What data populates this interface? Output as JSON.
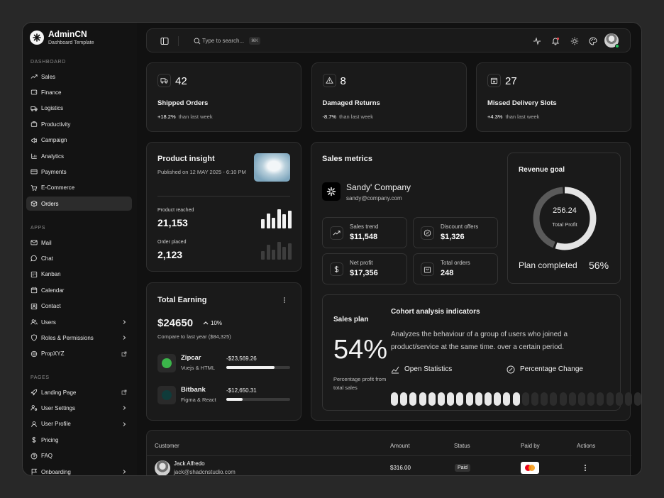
{
  "brand": {
    "title": "AdminCN",
    "subtitle": "Dashboard Template"
  },
  "sidebar": {
    "dashboard_label": "DASHBOARD",
    "apps_label": "APPS",
    "pages_label": "PAGES",
    "dashboard_items": [
      {
        "label": "Sales",
        "icon": "trending-up-icon"
      },
      {
        "label": "Finance",
        "icon": "wallet-icon"
      },
      {
        "label": "Logistics",
        "icon": "truck-icon"
      },
      {
        "label": "Productivity",
        "icon": "briefcase-icon"
      },
      {
        "label": "Campaign",
        "icon": "megaphone-icon"
      },
      {
        "label": "Analytics",
        "icon": "bar-chart-icon"
      },
      {
        "label": "Payments",
        "icon": "credit-card-icon"
      },
      {
        "label": "E-Commerce",
        "icon": "cart-icon"
      },
      {
        "label": "Orders",
        "icon": "box-icon"
      }
    ],
    "app_items": [
      {
        "label": "Mail",
        "icon": "mail-icon"
      },
      {
        "label": "Chat",
        "icon": "chat-icon"
      },
      {
        "label": "Kanban",
        "icon": "kanban-icon"
      },
      {
        "label": "Calendar",
        "icon": "calendar-icon"
      },
      {
        "label": "Contact",
        "icon": "contact-icon"
      },
      {
        "label": "Users",
        "icon": "users-icon"
      },
      {
        "label": "Roles & Permissions",
        "icon": "shield-icon"
      },
      {
        "label": "PropXYZ",
        "icon": "link-icon"
      }
    ],
    "page_items": [
      {
        "label": "Landing Page",
        "icon": "rocket-icon"
      },
      {
        "label": "User Settings",
        "icon": "user-cog-icon"
      },
      {
        "label": "User Profile",
        "icon": "user-icon"
      },
      {
        "label": "Pricing",
        "icon": "dollar-icon"
      },
      {
        "label": "FAQ",
        "icon": "help-icon"
      },
      {
        "label": "Onboarding",
        "icon": "flag-icon"
      }
    ]
  },
  "topbar": {
    "search_placeholder": "Type to search...",
    "shortcut": "⌘K"
  },
  "stats": [
    {
      "value": "42",
      "title": "Shipped Orders",
      "delta": "+18.2%",
      "delta_note": "than last week",
      "icon": "truck-icon"
    },
    {
      "value": "8",
      "title": "Damaged Returns",
      "delta": "-8.7%",
      "delta_note": "than last week",
      "icon": "alert-triangle-icon"
    },
    {
      "value": "27",
      "title": "Missed Delivery Slots",
      "delta": "+4.3%",
      "delta_note": "than last week",
      "icon": "calendar-x-icon"
    }
  ],
  "insight": {
    "title": "Product insight",
    "published": "Published on 12 MAY 2025 - 6:10 PM",
    "reached_label": "Product reached",
    "reached_value": "21,153",
    "placed_label": "Order placed",
    "placed_value": "2,123",
    "reached_bars": [
      0.45,
      0.75,
      0.55,
      0.95,
      0.7,
      0.9
    ],
    "placed_bars": [
      0.45,
      0.8,
      0.55,
      0.95,
      0.7,
      0.9
    ]
  },
  "earning": {
    "title": "Total Earning",
    "amount": "$24650",
    "change": "10%",
    "compare": "Compare to last year ($84,325)",
    "items": [
      {
        "name": "Zipcar",
        "sub": "Vuejs & HTML",
        "amount": "-$23,569.26",
        "progress": 0.75,
        "logo_color": "#3bb54a"
      },
      {
        "name": "Bitbank",
        "sub": "Figma & React",
        "amount": "-$12,650.31",
        "progress": 0.25,
        "logo_color": "#0f3b3a"
      }
    ]
  },
  "metrics": {
    "title": "Sales metrics",
    "company": "Sandy' Company",
    "email": "sandy@company.com",
    "tiles": [
      {
        "label": "Sales trend",
        "value": "$11,548",
        "icon": "trending-up-icon"
      },
      {
        "label": "Discount offers",
        "value": "$1,326",
        "icon": "percent-icon"
      },
      {
        "label": "Net profit",
        "value": "$17,356",
        "icon": "dollar-icon"
      },
      {
        "label": "Total orders",
        "value": "248",
        "icon": "bag-icon"
      }
    ]
  },
  "revenue": {
    "title": "Revenue goal",
    "value": "256.24",
    "label": "Total Profit",
    "plan_label": "Plan completed",
    "plan_value": "56%",
    "fraction": 0.56
  },
  "plan": {
    "title": "Sales plan",
    "percent": "54%",
    "note": "Percentage profit from total sales",
    "cohort_title": "Cohort analysis indicators",
    "cohort_desc": "Analyzes the behaviour of a group of users who joined a product/service at the same time. over a certain period.",
    "open_stats": "Open Statistics",
    "pct_change": "Percentage Change",
    "filled_fraction": 0.54
  },
  "table": {
    "headers": [
      "Customer",
      "Amount",
      "Status",
      "Paid by",
      "Actions"
    ],
    "rows": [
      {
        "name": "Jack Alfredo",
        "email": "jack@shadcnstudio.com",
        "amount": "$316.00",
        "status": "Paid"
      }
    ]
  }
}
